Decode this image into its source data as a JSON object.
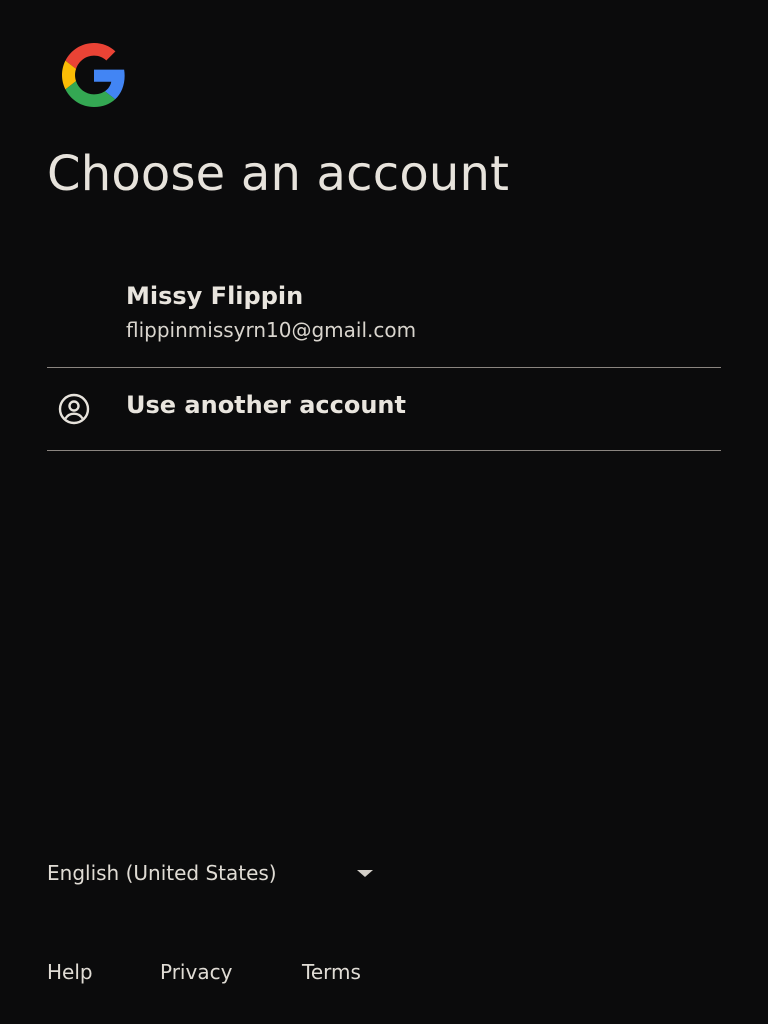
{
  "header": {
    "logo_icon": "google-g-logo",
    "title": "Choose an account"
  },
  "accounts": [
    {
      "name": "Missy Flippin",
      "email": "flippinmissyrn10@gmail.com"
    }
  ],
  "another_account": {
    "label": "Use another account",
    "icon": "account-circle-icon"
  },
  "language": {
    "selected": "English (United States)",
    "icon": "arrow-drop-down-icon"
  },
  "footer": {
    "links": [
      "Help",
      "Privacy",
      "Terms"
    ]
  },
  "colors": {
    "background": "#0b0b0c",
    "text": "#e7e3dc",
    "divider": "#8b8580",
    "google_red": "#EA4335",
    "google_yellow": "#FBBC05",
    "google_green": "#34A853",
    "google_blue": "#4285F4"
  }
}
